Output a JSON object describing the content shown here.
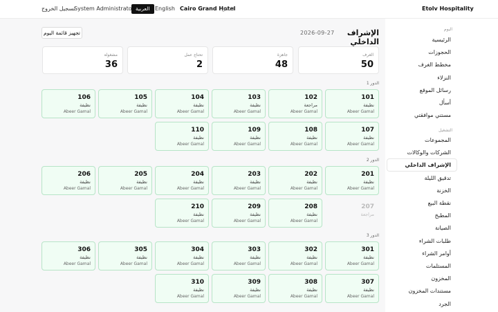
{
  "topbar": {
    "logout": "تسجيل الخروج",
    "user": "System Administrator",
    "lang_ar": "العربية",
    "lang_en": "English",
    "hotel": "Cairo Grand Hotel",
    "hotel_label": "الفندق",
    "brand": "Etolv Hospitality"
  },
  "sidebar": {
    "section_today": "اليوم",
    "section_ops": "التشغيل",
    "items_today": [
      "الرئيسية",
      "الحجوزات",
      "مخطط الغرف",
      "النزلاء",
      "رسائل الموقع",
      "أسأل",
      "مستني موافقتي"
    ],
    "items_ops": [
      "المجموعات",
      "الشركات والوكالات",
      "الإشراف الداخلي",
      "تدقيق الليلة",
      "الخزنة",
      "نقطة البيع",
      "المطبخ",
      "الصيانة",
      "طلبات الشراء",
      "أوامر الشراء",
      "المستلمات",
      "المخزون",
      "مستندات المخزون",
      "الجرد"
    ]
  },
  "header": {
    "title": "الإشراف الداخلي",
    "date": "2026-09-27",
    "prep_button": "تجهيز قائمة اليوم"
  },
  "stats": [
    {
      "label": "الغرف",
      "value": "50"
    },
    {
      "label": "جاهزة",
      "value": "48"
    },
    {
      "label": "تحتاج عمل",
      "value": "2"
    },
    {
      "label": "مشغولة",
      "value": "36"
    }
  ],
  "floors": [
    {
      "label": "الدور 1",
      "rooms": [
        {
          "num": "101",
          "status": "نظيفة",
          "staff": "Abeer Gamal"
        },
        {
          "num": "102",
          "status": "مراجعة",
          "staff": "Abeer Gamal"
        },
        {
          "num": "103",
          "status": "نظيفة",
          "staff": "Abeer Gamal"
        },
        {
          "num": "104",
          "status": "نظيفة",
          "staff": "Abeer Gamal"
        },
        {
          "num": "105",
          "status": "نظيفة",
          "staff": "Abeer Gamal"
        },
        {
          "num": "106",
          "status": "نظيفة",
          "staff": "Abeer Gamal"
        },
        {
          "num": "107",
          "status": "نظيفة",
          "staff": "Abeer Gamal"
        },
        {
          "num": "108",
          "status": "نظيفة",
          "staff": "Abeer Gamal"
        },
        {
          "num": "109",
          "status": "نظيفة",
          "staff": "Abeer Gamal"
        },
        {
          "num": "110",
          "status": "نظيفة",
          "staff": "Abeer Gamal"
        }
      ]
    },
    {
      "label": "الدور 2",
      "rooms": [
        {
          "num": "201",
          "status": "نظيفة",
          "staff": "Abeer Gamal"
        },
        {
          "num": "202",
          "status": "نظيفة",
          "staff": "Abeer Gamal"
        },
        {
          "num": "203",
          "status": "نظيفة",
          "staff": "Abeer Gamal"
        },
        {
          "num": "204",
          "status": "نظيفة",
          "staff": "Abeer Gamal"
        },
        {
          "num": "205",
          "status": "نظيفة",
          "staff": "Abeer Gamal"
        },
        {
          "num": "206",
          "status": "نظيفة",
          "staff": "Abeer Gamal"
        },
        {
          "num": "207",
          "status": "مراجعة",
          "staff": "",
          "disabled": true
        },
        {
          "num": "208",
          "status": "نظيفة",
          "staff": "Abeer Gamal"
        },
        {
          "num": "209",
          "status": "نظيفة",
          "staff": "Abeer Gamal"
        },
        {
          "num": "210",
          "status": "نظيفة",
          "staff": "Abeer Gamal"
        }
      ]
    },
    {
      "label": "الدور 3",
      "rooms": [
        {
          "num": "301",
          "status": "نظيفة",
          "staff": "Abeer Gamal"
        },
        {
          "num": "302",
          "status": "نظيفة",
          "staff": "Abeer Gamal"
        },
        {
          "num": "303",
          "status": "نظيفة",
          "staff": "Abeer Gamal"
        },
        {
          "num": "304",
          "status": "نظيفة",
          "staff": "Abeer Gamal"
        },
        {
          "num": "305",
          "status": "نظيفة",
          "staff": "Abeer Gamal"
        },
        {
          "num": "306",
          "status": "نظيفة",
          "staff": "Abeer Gamal"
        },
        {
          "num": "307",
          "status": "نظيفة",
          "staff": "Abeer Gamal"
        },
        {
          "num": "308",
          "status": "نظيفة",
          "staff": "Abeer Gamal"
        },
        {
          "num": "309",
          "status": "نظيفة",
          "staff": "Abeer Gamal"
        },
        {
          "num": "310",
          "status": "نظيفة",
          "staff": "Abeer Gamal"
        }
      ]
    }
  ],
  "colors": {
    "room_bg": "#f0fdf4",
    "room_border": "#b7e4c7",
    "active_lang": "#111111"
  }
}
